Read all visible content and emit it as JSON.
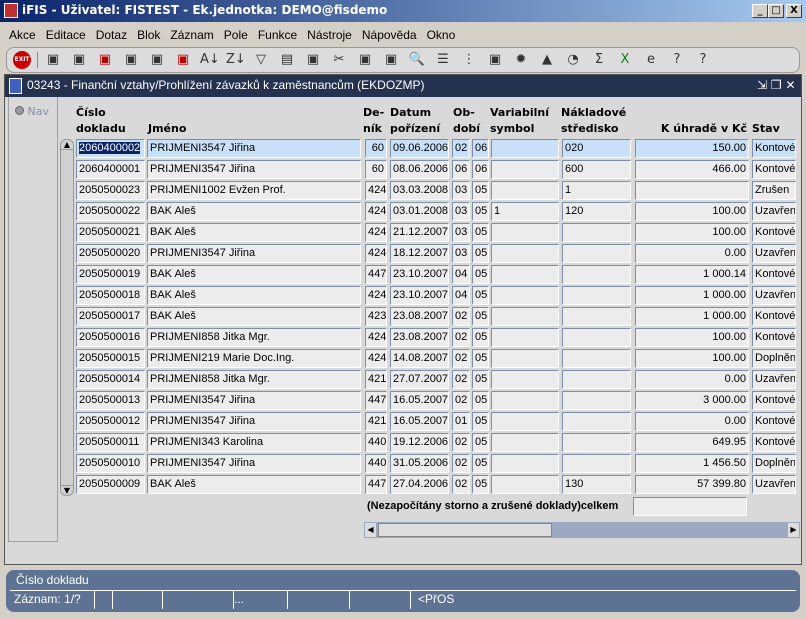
{
  "window": {
    "title": "iFIS - Uživatel: FISTEST - Ek.jednotka: DEMO@fisdemo",
    "min": "_",
    "max": "□",
    "close": "X"
  },
  "menu": [
    "Akce",
    "Editace",
    "Dotaz",
    "Blok",
    "Záznam",
    "Pole",
    "Funkce",
    "Nástroje",
    "Nápověda",
    "Okno"
  ],
  "toolbar": {
    "exit": "EXIT",
    "icons": [
      "new-record-icon",
      "save-icon",
      "delete-record-icon",
      "query-icon",
      "execute-query-icon",
      "cancel-query-icon",
      "sort-asc-icon",
      "sort-desc-icon",
      "filter-icon",
      "print-icon",
      "print-setup-icon",
      "cut-icon",
      "copy-icon",
      "paste-icon",
      "find-icon",
      "list-icon",
      "tree-icon",
      "calculator-icon",
      "settings-icon",
      "warning-icon",
      "clock-icon",
      "sum-icon",
      "excel-icon",
      "browser-icon",
      "help-icon",
      "context-help-icon"
    ],
    "sum_glyph": "Σ"
  },
  "form": {
    "title": "03243 - Finanční vztahy/Prohlížení závazků k zaměstnancům (EKDOZMP)",
    "nav": "Nav"
  },
  "columns": {
    "cislo": [
      "Číslo",
      "dokladu"
    ],
    "jmeno": "Jméno",
    "denik": [
      "De-",
      "ník"
    ],
    "datum": [
      "Datum",
      "pořízení"
    ],
    "obdobi": [
      "Ob-",
      "dobí"
    ],
    "vs": [
      "Variabilní",
      "symbol"
    ],
    "ns": [
      "Nákladové",
      "středisko"
    ],
    "kuhrade": "K úhradě v Kč",
    "stav": "Stav"
  },
  "rows": [
    [
      "2060400002",
      "PRIJMENI3547 Jiřina",
      "60",
      "09.06.2006",
      "02",
      "06",
      "",
      "020",
      "150.00",
      "Kontové"
    ],
    [
      "2060400001",
      "PRIJMENI3547 Jiřina",
      "60",
      "08.06.2006",
      "06",
      "06",
      "",
      "600",
      "466.00",
      "Kontové"
    ],
    [
      "2050500023",
      "PRIJMENI1002 Evžen Prof.",
      "424",
      "03.03.2008",
      "03",
      "05",
      "",
      "1",
      "",
      "Zrušen"
    ],
    [
      "2050500022",
      "BAK Aleš",
      "424",
      "03.01.2008",
      "03",
      "05",
      "1",
      "120",
      "100.00",
      "Uzavřen"
    ],
    [
      "2050500021",
      "BAK Aleš",
      "424",
      "21.12.2007",
      "03",
      "05",
      "",
      "",
      "100.00",
      "Kontové"
    ],
    [
      "2050500020",
      "PRIJMENI3547 Jiřina",
      "424",
      "18.12.2007",
      "03",
      "05",
      "",
      "",
      "0.00",
      "Uzavřen"
    ],
    [
      "2050500019",
      "BAK Aleš",
      "447",
      "23.10.2007",
      "04",
      "05",
      "",
      "",
      "1 000.14",
      "Kontové"
    ],
    [
      "2050500018",
      "BAK Aleš",
      "424",
      "23.10.2007",
      "04",
      "05",
      "",
      "",
      "1 000.00",
      "Uzavřen"
    ],
    [
      "2050500017",
      "BAK Aleš",
      "423",
      "23.08.2007",
      "02",
      "05",
      "",
      "",
      "1 000.00",
      "Kontové"
    ],
    [
      "2050500016",
      "PRIJMENI858 Jitka Mgr.",
      "424",
      "23.08.2007",
      "02",
      "05",
      "",
      "",
      "100.00",
      "Kontové"
    ],
    [
      "2050500015",
      "PRIJMENI219 Marie Doc.Ing.",
      "424",
      "14.08.2007",
      "02",
      "05",
      "",
      "",
      "100.00",
      "Doplněn"
    ],
    [
      "2050500014",
      "PRIJMENI858 Jitka Mgr.",
      "421",
      "27.07.2007",
      "02",
      "05",
      "",
      "",
      "0.00",
      "Uzavřen"
    ],
    [
      "2050500013",
      "PRIJMENI3547 Jiřina",
      "447",
      "16.05.2007",
      "02",
      "05",
      "",
      "",
      "3 000.00",
      "Kontové"
    ],
    [
      "2050500012",
      "PRIJMENI3547 Jiřina",
      "421",
      "16.05.2007",
      "01",
      "05",
      "",
      "",
      "0.00",
      "Kontové"
    ],
    [
      "2050500011",
      "PRIJMENI343 Karolina",
      "440",
      "19.12.2006",
      "02",
      "05",
      "",
      "",
      "649.95",
      "Kontové"
    ],
    [
      "2050500010",
      "PRIJMENI3547 Jiřina",
      "440",
      "31.05.2006",
      "02",
      "05",
      "",
      "",
      "1 456.50",
      "Doplněn"
    ],
    [
      "2050500009",
      "BAK Aleš",
      "447",
      "27.04.2006",
      "02",
      "05",
      "",
      "130",
      "57 399.80",
      "Uzavřen"
    ]
  ],
  "total": {
    "label": "(Nezapočítány storno a zrušené doklady)celkem",
    "value": ""
  },
  "status": {
    "field": "Číslo dokladu",
    "record": "Záznam: 1/?",
    "ellipsis": "...",
    "mode": "<PřOS"
  },
  "colors": {
    "titlebar": "#0a246a",
    "form_title": "#24324f",
    "selected_row": "#c8e0f8",
    "status": "#5e7394"
  }
}
